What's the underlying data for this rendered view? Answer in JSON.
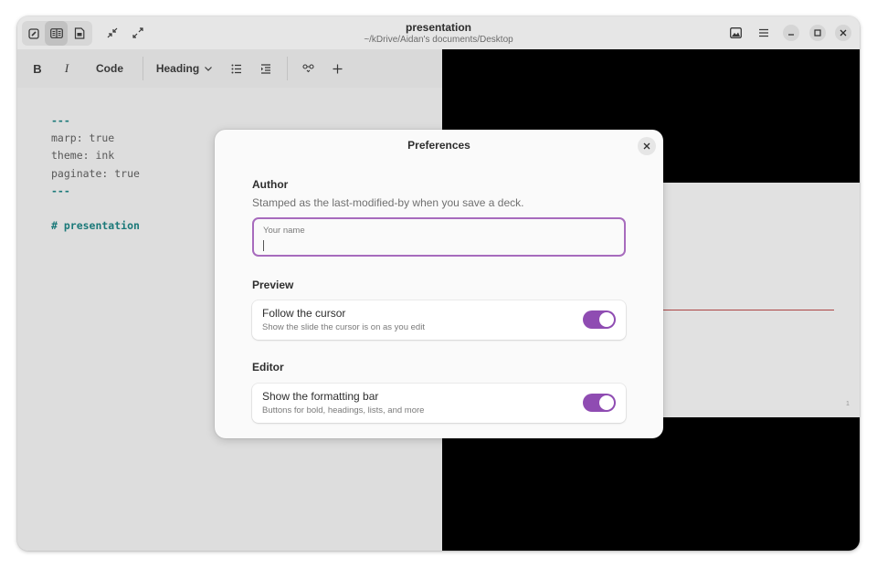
{
  "window": {
    "title": "presentation",
    "subtitle": "~/kDrive/Aidan's documents/Desktop",
    "view_modes": [
      {
        "name": "editor-view",
        "icon": "edit-icon",
        "active": false
      },
      {
        "name": "split-view",
        "icon": "split-view-icon",
        "active": true
      },
      {
        "name": "preview-view",
        "icon": "preview-icon",
        "active": false
      }
    ],
    "header_icons": [
      "shrink-icon",
      "expand-icon",
      "image-icon",
      "menu-icon"
    ],
    "controls": [
      "minimize-icon",
      "maximize-icon",
      "close-icon"
    ]
  },
  "toolbar": {
    "bold": "B",
    "italic": "I",
    "code": "Code",
    "heading": "Heading",
    "icons": [
      "list-icon",
      "indent-icon",
      "link-icon",
      "plus-icon"
    ]
  },
  "editor": {
    "lines": [
      "---",
      "marp: true",
      "theme: ink",
      "paginate: true",
      "---",
      "",
      "# presentation"
    ]
  },
  "preview": {
    "page_number": "1"
  },
  "preferences": {
    "title": "Preferences",
    "author": {
      "heading": "Author",
      "description": "Stamped as the last-modified-by when you save a deck.",
      "placeholder": "Your name",
      "value": ""
    },
    "preview": {
      "heading": "Preview",
      "follow_title": "Follow the cursor",
      "follow_subtitle": "Show the slide the cursor is on as you edit",
      "follow_enabled": true
    },
    "editor": {
      "heading": "Editor",
      "bar_title": "Show the formatting bar",
      "bar_subtitle": "Buttons for bold, headings, lists, and more",
      "bar_enabled": true
    }
  },
  "colors": {
    "accent": "#8f4cb2",
    "focus_border": "#a76bbd",
    "yaml_teal": "#1c7c7c",
    "slide_rule": "#b04848"
  }
}
